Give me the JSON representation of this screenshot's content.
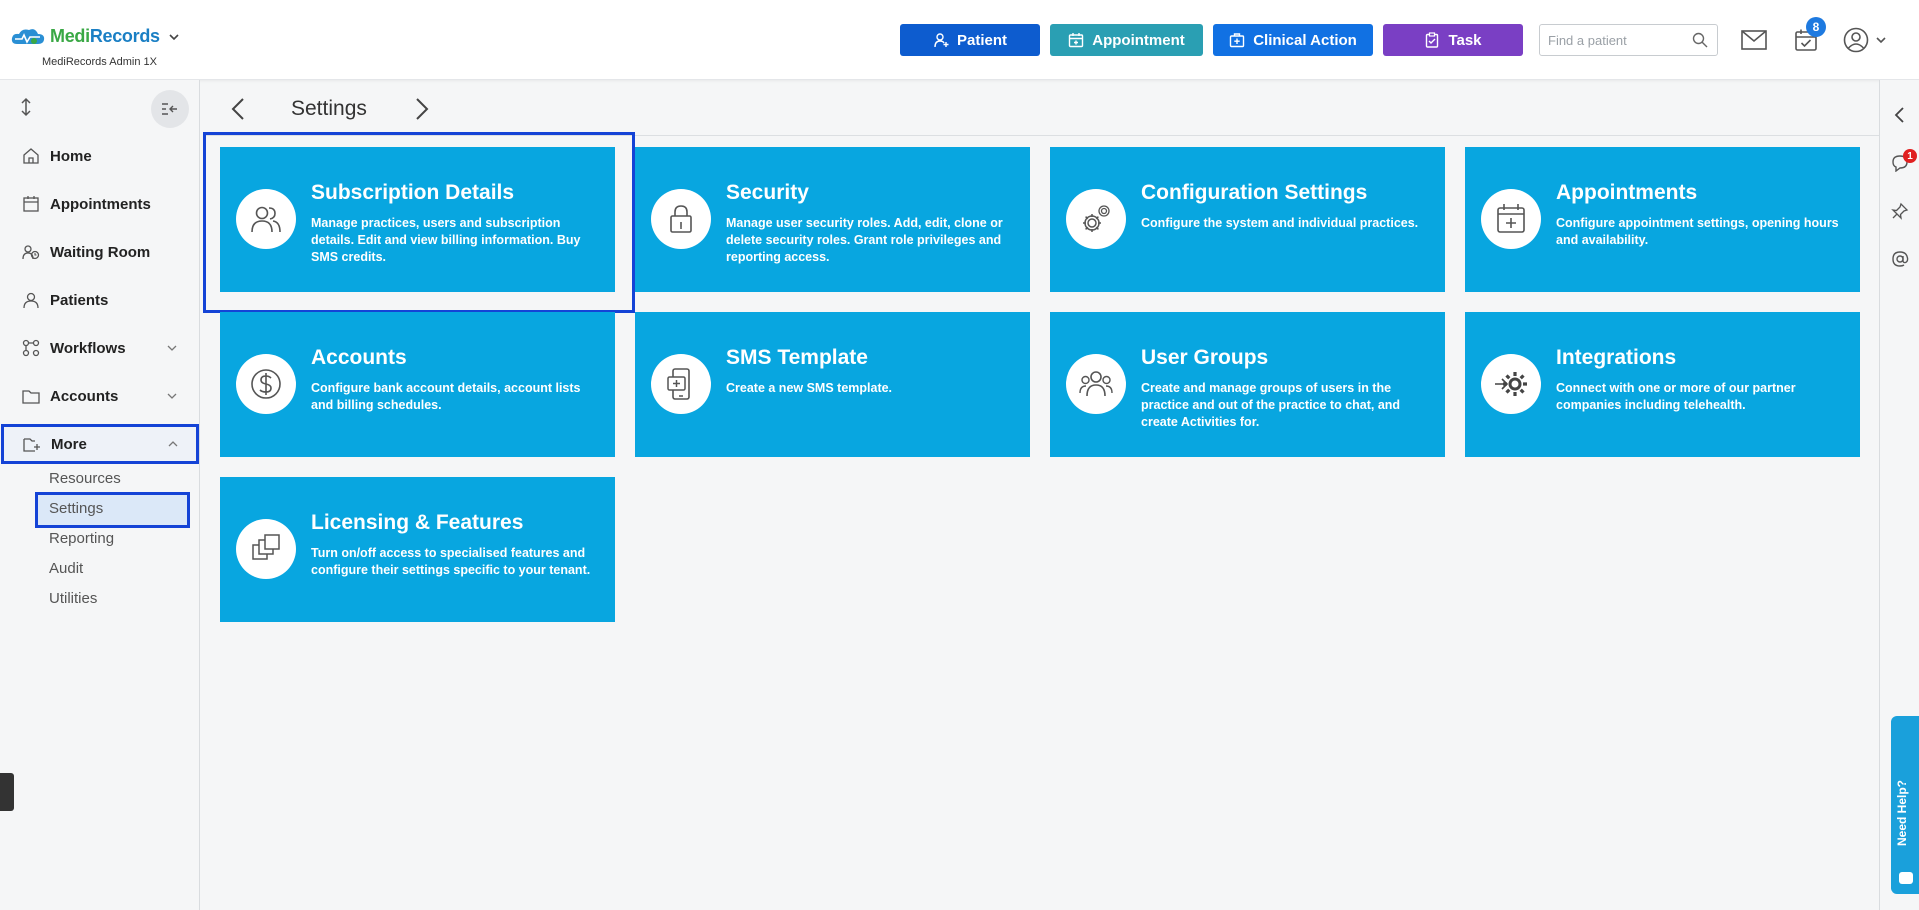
{
  "header": {
    "brand_part1": "Medi",
    "brand_part2": "Records",
    "subtitle": "MediRecords Admin 1X",
    "buttons": {
      "patient": "Patient",
      "appointment": "Appointment",
      "clinical_action": "Clinical Action",
      "task": "Task"
    },
    "search_placeholder": "Find a patient",
    "calendar_badge": "8"
  },
  "sidebar": {
    "items": [
      {
        "label": "Home"
      },
      {
        "label": "Appointments"
      },
      {
        "label": "Waiting Room"
      },
      {
        "label": "Patients"
      },
      {
        "label": "Workflows"
      },
      {
        "label": "Accounts"
      },
      {
        "label": "More"
      }
    ],
    "more_sub": [
      "Resources",
      "Settings",
      "Reporting",
      "Audit",
      "Utilities"
    ]
  },
  "breadcrumb": {
    "title": "Settings"
  },
  "tiles": [
    {
      "title": "Subscription Details",
      "desc": "Manage practices, users and subscription details. Edit and view billing information. Buy SMS credits."
    },
    {
      "title": "Security",
      "desc": "Manage user security roles. Add, edit, clone or delete security roles. Grant role privileges and reporting access."
    },
    {
      "title": "Configuration Settings",
      "desc": "Configure the system and individual practices."
    },
    {
      "title": "Appointments",
      "desc": "Configure appointment settings, opening hours and availability."
    },
    {
      "title": "Accounts",
      "desc": "Configure bank account details, account lists and billing schedules."
    },
    {
      "title": "SMS Template",
      "desc": "Create a new SMS template."
    },
    {
      "title": "User Groups",
      "desc": "Create and manage groups of users in the practice and out of the practice to chat, and create Activities for."
    },
    {
      "title": "Integrations",
      "desc": "Connect with one or more of our partner companies including telehealth."
    },
    {
      "title": "Licensing & Features",
      "desc": "Turn on/off access to specialised features and configure their settings specific to your tenant."
    }
  ],
  "rail": {
    "notification_badge": "1",
    "need_help": "Need Help?"
  },
  "colors": {
    "tile": "#08a6e0",
    "patient_btn": "#0d5ccf",
    "appointment_btn": "#2a9fb3",
    "clinical_btn": "#1171e3",
    "task_btn": "#7a3fc4",
    "selection": "#1443d6"
  }
}
